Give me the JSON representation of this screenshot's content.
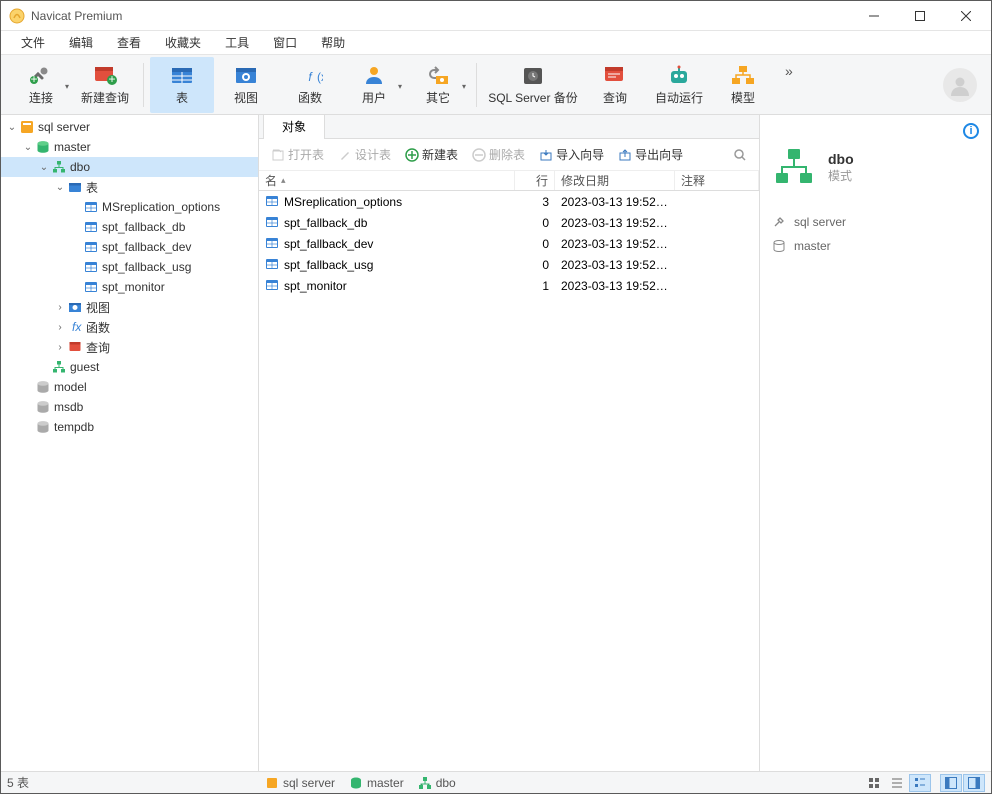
{
  "app": {
    "title": "Navicat Premium"
  },
  "menu": [
    "文件",
    "编辑",
    "查看",
    "收藏夹",
    "工具",
    "窗口",
    "帮助"
  ],
  "toolbar": [
    {
      "id": "connect",
      "label": "连接",
      "drop": true
    },
    {
      "id": "new-query",
      "label": "新建查询"
    },
    {
      "id": "table",
      "label": "表",
      "active": true
    },
    {
      "id": "view",
      "label": "视图"
    },
    {
      "id": "function",
      "label": "函数"
    },
    {
      "id": "user",
      "label": "用户",
      "drop": true
    },
    {
      "id": "other",
      "label": "其它",
      "drop": true
    },
    {
      "id": "backup",
      "label": "SQL Server 备份",
      "wide": true
    },
    {
      "id": "query",
      "label": "查询"
    },
    {
      "id": "automation",
      "label": "自动运行"
    },
    {
      "id": "model",
      "label": "模型"
    }
  ],
  "tree": [
    {
      "depth": 0,
      "arrow": "open",
      "icon": "server",
      "label": "sql server"
    },
    {
      "depth": 1,
      "arrow": "open",
      "icon": "db",
      "label": "master"
    },
    {
      "depth": 2,
      "arrow": "open",
      "icon": "schema",
      "label": "dbo",
      "selected": true
    },
    {
      "depth": 3,
      "arrow": "open",
      "icon": "folder-table",
      "label": "表"
    },
    {
      "depth": 4,
      "arrow": "",
      "icon": "table",
      "label": "MSreplication_options"
    },
    {
      "depth": 4,
      "arrow": "",
      "icon": "table",
      "label": "spt_fallback_db"
    },
    {
      "depth": 4,
      "arrow": "",
      "icon": "table",
      "label": "spt_fallback_dev"
    },
    {
      "depth": 4,
      "arrow": "",
      "icon": "table",
      "label": "spt_fallback_usg"
    },
    {
      "depth": 4,
      "arrow": "",
      "icon": "table",
      "label": "spt_monitor"
    },
    {
      "depth": 3,
      "arrow": "closed",
      "icon": "view",
      "label": "视图"
    },
    {
      "depth": 3,
      "arrow": "closed",
      "icon": "fx",
      "label": "函数"
    },
    {
      "depth": 3,
      "arrow": "closed",
      "icon": "query",
      "label": "查询"
    },
    {
      "depth": 2,
      "arrow": "",
      "icon": "schema",
      "label": "guest"
    },
    {
      "depth": 1,
      "arrow": "",
      "icon": "db-off",
      "label": "model"
    },
    {
      "depth": 1,
      "arrow": "",
      "icon": "db-off",
      "label": "msdb"
    },
    {
      "depth": 1,
      "arrow": "",
      "icon": "db-off",
      "label": "tempdb"
    }
  ],
  "tabs": {
    "active": "对象"
  },
  "ops": {
    "open": "打开表",
    "design": "设计表",
    "new": "新建表",
    "delete": "删除表",
    "import": "导入向导",
    "export": "导出向导"
  },
  "columns": {
    "name": "名",
    "rows": "行",
    "date": "修改日期",
    "note": "注释"
  },
  "rows": [
    {
      "name": "MSreplication_options",
      "rows": "3",
      "date": "2023-03-13 19:52:..."
    },
    {
      "name": "spt_fallback_db",
      "rows": "0",
      "date": "2023-03-13 19:52:..."
    },
    {
      "name": "spt_fallback_dev",
      "rows": "0",
      "date": "2023-03-13 19:52:..."
    },
    {
      "name": "spt_fallback_usg",
      "rows": "0",
      "date": "2023-03-13 19:52:..."
    },
    {
      "name": "spt_monitor",
      "rows": "1",
      "date": "2023-03-13 19:52:..."
    }
  ],
  "right": {
    "schema_name": "dbo",
    "schema_type": "模式",
    "connection": "sql server",
    "database": "master"
  },
  "status": {
    "count": "5 表",
    "crumbs": [
      "sql server",
      "master",
      "dbo"
    ]
  }
}
